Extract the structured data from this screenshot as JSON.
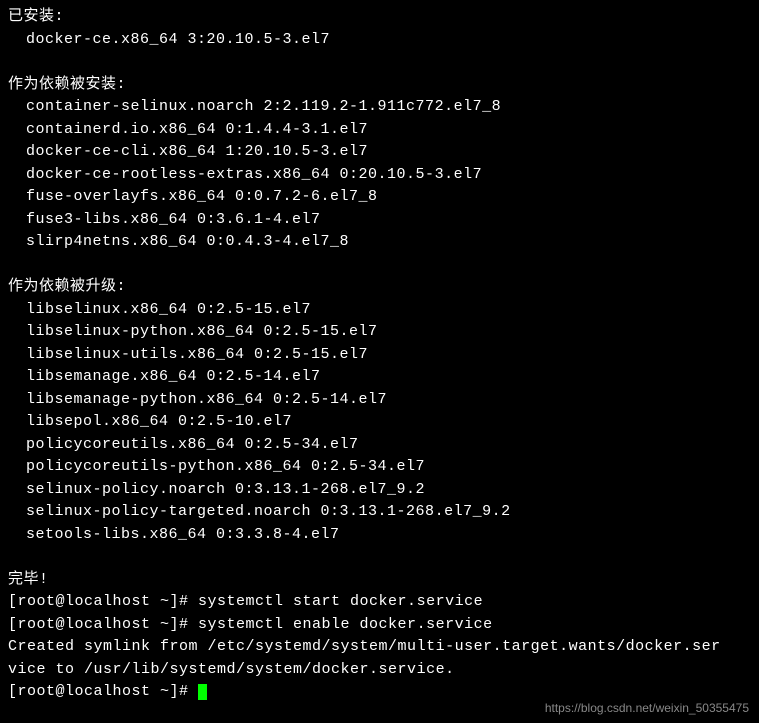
{
  "sections": {
    "installed": {
      "header": "已安装:",
      "packages": [
        "docker-ce.x86_64 3:20.10.5-3.el7"
      ]
    },
    "dep_installed": {
      "header": "作为依赖被安装:",
      "packages": [
        "container-selinux.noarch 2:2.119.2-1.911c772.el7_8",
        "containerd.io.x86_64 0:1.4.4-3.1.el7",
        "docker-ce-cli.x86_64 1:20.10.5-3.el7",
        "docker-ce-rootless-extras.x86_64 0:20.10.5-3.el7",
        "fuse-overlayfs.x86_64 0:0.7.2-6.el7_8",
        "fuse3-libs.x86_64 0:3.6.1-4.el7",
        "slirp4netns.x86_64 0:0.4.3-4.el7_8"
      ]
    },
    "dep_upgraded": {
      "header": "作为依赖被升级:",
      "packages": [
        "libselinux.x86_64 0:2.5-15.el7",
        "libselinux-python.x86_64 0:2.5-15.el7",
        "libselinux-utils.x86_64 0:2.5-15.el7",
        "libsemanage.x86_64 0:2.5-14.el7",
        "libsemanage-python.x86_64 0:2.5-14.el7",
        "libsepol.x86_64 0:2.5-10.el7",
        "policycoreutils.x86_64 0:2.5-34.el7",
        "policycoreutils-python.x86_64 0:2.5-34.el7",
        "selinux-policy.noarch 0:3.13.1-268.el7_9.2",
        "selinux-policy-targeted.noarch 0:3.13.1-268.el7_9.2",
        "setools-libs.x86_64 0:3.3.8-4.el7"
      ]
    }
  },
  "complete": "完毕!",
  "prompts": {
    "line1": "[root@localhost ~]# systemctl start docker.service",
    "line2": "[root@localhost ~]# systemctl enable docker.service",
    "output1": "Created symlink from /etc/systemd/system/multi-user.target.wants/docker.ser",
    "output2": "vice to /usr/lib/systemd/system/docker.service.",
    "line3": "[root@localhost ~]# "
  },
  "watermark": "https://blog.csdn.net/weixin_50355475"
}
